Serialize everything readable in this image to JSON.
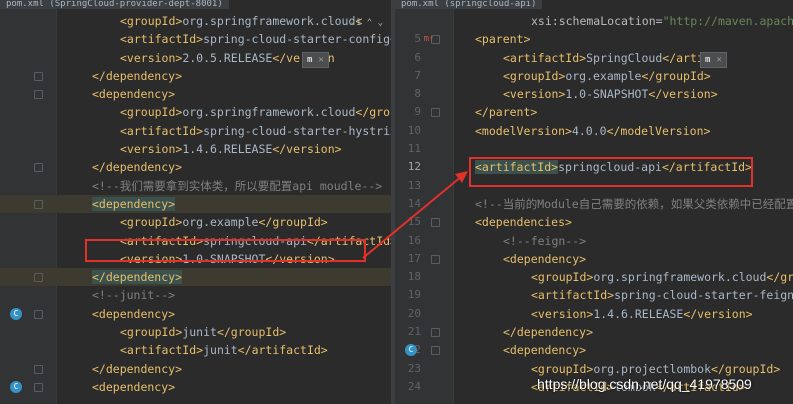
{
  "left": {
    "tab": "pom.xml (SpringCloud-provider-dept-8001)",
    "lines": [
      {
        "n": "",
        "indent": 2,
        "parts": [
          [
            "tag",
            "<groupId>"
          ],
          [
            "txt",
            "org.springframework.cloud"
          ],
          [
            "tag",
            "<"
          ]
        ]
      },
      {
        "n": "",
        "indent": 2,
        "parts": [
          [
            "tag",
            "<artifactId>"
          ],
          [
            "txt",
            "spring-cloud-starter-config"
          ],
          [
            "tag",
            "</arti"
          ]
        ]
      },
      {
        "n": "",
        "indent": 2,
        "parts": [
          [
            "tag",
            "<version>"
          ],
          [
            "txt",
            "2.0.5.RELEASE"
          ],
          [
            "tag",
            "</version"
          ]
        ]
      },
      {
        "n": "",
        "indent": 1,
        "parts": [
          [
            "tag",
            "</dependency>"
          ]
        ]
      },
      {
        "n": "",
        "indent": 1,
        "parts": [
          [
            "tag",
            "<dependency>"
          ]
        ]
      },
      {
        "n": "",
        "indent": 2,
        "parts": [
          [
            "tag",
            "<groupId>"
          ],
          [
            "txt",
            "org.springframework.cloud"
          ],
          [
            "tag",
            "</groupId>"
          ]
        ]
      },
      {
        "n": "",
        "indent": 2,
        "parts": [
          [
            "tag",
            "<artifactId>"
          ],
          [
            "txt",
            "spring-cloud-starter-hystrix"
          ],
          [
            "tag",
            "</art"
          ]
        ]
      },
      {
        "n": "",
        "indent": 2,
        "parts": [
          [
            "tag",
            "<version>"
          ],
          [
            "txt",
            "1.4.6.RELEASE"
          ],
          [
            "tag",
            "</version>"
          ]
        ]
      },
      {
        "n": "",
        "indent": 1,
        "parts": [
          [
            "tag",
            "</dependency>"
          ]
        ]
      },
      {
        "n": "",
        "indent": 1,
        "parts": [
          [
            "cmt",
            "<!--我们需要拿到实体类，所以要配置api moudle-->"
          ]
        ]
      },
      {
        "n": "",
        "indent": 1,
        "parts": [
          [
            "tagsel",
            "<dependency>"
          ]
        ]
      },
      {
        "n": "",
        "indent": 2,
        "parts": [
          [
            "tag",
            "<groupId>"
          ],
          [
            "txt",
            "org.example"
          ],
          [
            "tag",
            "</groupId>"
          ]
        ]
      },
      {
        "n": "",
        "indent": 2,
        "parts": [
          [
            "tag",
            "<artifactId>"
          ],
          [
            "txt",
            "springcloud-api"
          ],
          [
            "tag",
            "</artifactId>"
          ]
        ]
      },
      {
        "n": "",
        "indent": 2,
        "parts": [
          [
            "tag",
            "<version>"
          ],
          [
            "txt",
            "1.0-SNAPSHOT"
          ],
          [
            "tag",
            "</version>"
          ]
        ]
      },
      {
        "n": "",
        "indent": 1,
        "parts": [
          [
            "tagsel",
            "</dependency>"
          ]
        ]
      },
      {
        "n": "",
        "indent": 1,
        "parts": [
          [
            "cmt",
            "<!--junit-->"
          ]
        ]
      },
      {
        "n": "",
        "indent": 1,
        "parts": [
          [
            "tag",
            "<dependency>"
          ]
        ]
      },
      {
        "n": "",
        "indent": 2,
        "parts": [
          [
            "tag",
            "<groupId>"
          ],
          [
            "txt",
            "junit"
          ],
          [
            "tag",
            "</groupId>"
          ]
        ]
      },
      {
        "n": "",
        "indent": 2,
        "parts": [
          [
            "tag",
            "<artifactId>"
          ],
          [
            "txt",
            "junit"
          ],
          [
            "tag",
            "</artifactId>"
          ]
        ]
      },
      {
        "n": "",
        "indent": 1,
        "parts": [
          [
            "tag",
            "</dependency>"
          ]
        ]
      },
      {
        "n": "",
        "indent": 1,
        "parts": [
          [
            "tag",
            "<dependency>"
          ]
        ]
      }
    ],
    "inspection": "1",
    "popup_label": "m"
  },
  "right": {
    "tab": "pom.xml (springcloud-api)",
    "lines": [
      {
        "n": "",
        "indent": 2,
        "parts": [
          [
            "attr",
            "xsi:schemaLocation="
          ],
          [
            "aval",
            "\"http://maven.apache.o"
          ]
        ]
      },
      {
        "n": "5",
        "indent": 0,
        "parts": [
          [
            "tag",
            "<parent>"
          ]
        ]
      },
      {
        "n": "6",
        "indent": 1,
        "parts": [
          [
            "tag",
            "<artifactId>"
          ],
          [
            "txt",
            "SpringCloud"
          ],
          [
            "tag",
            "</artif"
          ]
        ]
      },
      {
        "n": "7",
        "indent": 1,
        "parts": [
          [
            "tag",
            "<groupId>"
          ],
          [
            "txt",
            "org.example"
          ],
          [
            "tag",
            "</groupId>"
          ]
        ]
      },
      {
        "n": "8",
        "indent": 1,
        "parts": [
          [
            "tag",
            "<version>"
          ],
          [
            "txt",
            "1.0-SNAPSHOT"
          ],
          [
            "tag",
            "</version>"
          ]
        ]
      },
      {
        "n": "9",
        "indent": 0,
        "parts": [
          [
            "tag",
            "</parent>"
          ]
        ]
      },
      {
        "n": "10",
        "indent": 0,
        "parts": [
          [
            "tag",
            "<modelVersion>"
          ],
          [
            "txt",
            "4.0.0"
          ],
          [
            "tag",
            "</modelVersion>"
          ]
        ]
      },
      {
        "n": "11",
        "indent": 0,
        "parts": []
      },
      {
        "n": "12",
        "indent": 0,
        "parts": [
          [
            "tagsel",
            "<artifactId>"
          ],
          [
            "txt",
            "springcloud-api"
          ],
          [
            "tag",
            "</artifactId>"
          ]
        ]
      },
      {
        "n": "13",
        "indent": 0,
        "parts": []
      },
      {
        "n": "14",
        "indent": 0,
        "parts": [
          [
            "cmt",
            "<!--当前的Module自己需要的依赖，如果父类依赖中已经配置"
          ]
        ]
      },
      {
        "n": "15",
        "indent": 0,
        "parts": [
          [
            "tag",
            "<dependencies>"
          ]
        ]
      },
      {
        "n": "16",
        "indent": 1,
        "parts": [
          [
            "cmt",
            "<!--feign-->"
          ]
        ]
      },
      {
        "n": "17",
        "indent": 1,
        "parts": [
          [
            "tag",
            "<dependency>"
          ]
        ]
      },
      {
        "n": "18",
        "indent": 2,
        "parts": [
          [
            "tag",
            "<groupId>"
          ],
          [
            "txt",
            "org.springframework.cloud"
          ],
          [
            "tag",
            "</grou"
          ]
        ]
      },
      {
        "n": "19",
        "indent": 2,
        "parts": [
          [
            "tag",
            "<artifactId>"
          ],
          [
            "txt",
            "spring-cloud-starter-feign"
          ],
          [
            "tag",
            "</"
          ]
        ]
      },
      {
        "n": "20",
        "indent": 2,
        "parts": [
          [
            "tag",
            "<version>"
          ],
          [
            "txt",
            "1.4.6.RELEASE"
          ],
          [
            "tag",
            "</version>"
          ]
        ]
      },
      {
        "n": "21",
        "indent": 1,
        "parts": [
          [
            "tag",
            "</dependency>"
          ]
        ]
      },
      {
        "n": "22",
        "indent": 1,
        "parts": [
          [
            "tag",
            "<dependency>"
          ]
        ]
      },
      {
        "n": "23",
        "indent": 2,
        "parts": [
          [
            "tag",
            "<groupId>"
          ],
          [
            "txt",
            "org.projectlombok"
          ],
          [
            "tag",
            "</groupId>"
          ]
        ]
      },
      {
        "n": "24",
        "indent": 2,
        "parts": [
          [
            "tag",
            "<artifactId>"
          ],
          [
            "txt",
            "lombok"
          ],
          [
            "tag",
            "</artifactId>"
          ]
        ]
      }
    ],
    "popup_label": "m"
  },
  "watermark": "https://blog.csdn.net/qq_41978509",
  "colors": {
    "highlight_box": "#e0312b",
    "tag": "#e8bf6a",
    "comment": "#808080",
    "text": "#a9b7c6",
    "background": "#2b2b2b"
  },
  "icons": {
    "inspection": "check-icon",
    "override": "override-icon",
    "gutter_run": "maven-run-icon"
  }
}
